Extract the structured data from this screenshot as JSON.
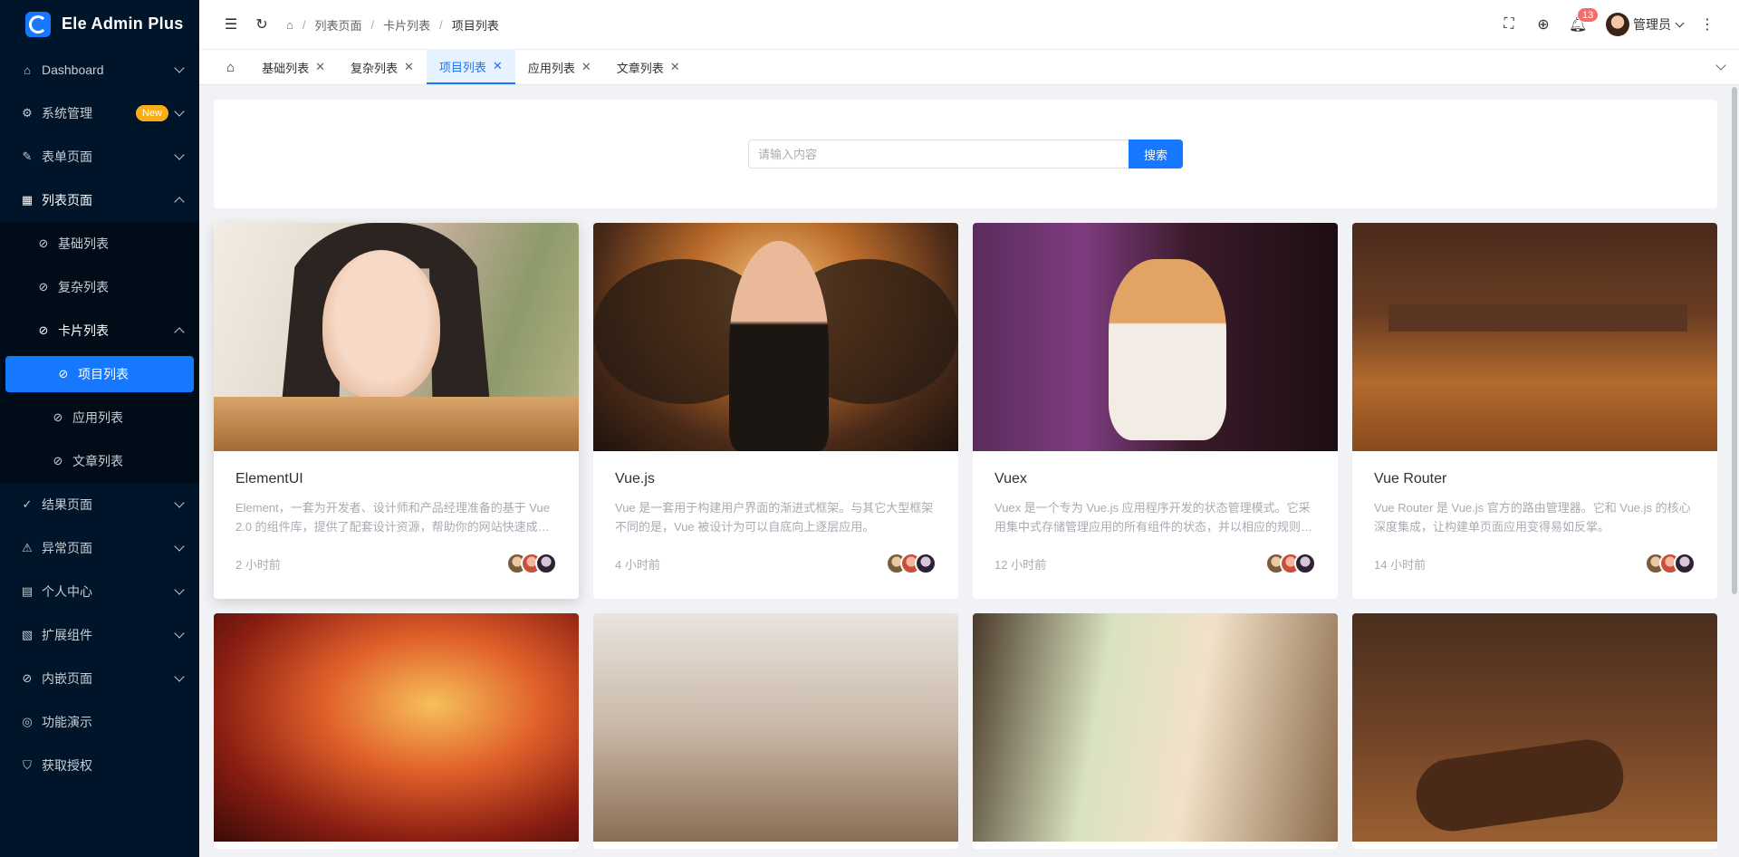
{
  "app": {
    "title": "Ele Admin Plus"
  },
  "sidebar": {
    "items": [
      {
        "label": "Dashboard",
        "icon": "home-icon"
      },
      {
        "label": "系统管理",
        "icon": "gear-icon",
        "badge": "New"
      },
      {
        "label": "表单页面",
        "icon": "edit-icon"
      },
      {
        "label": "列表页面",
        "icon": "table-icon"
      },
      {
        "label": "结果页面",
        "icon": "check-circle-icon"
      },
      {
        "label": "异常页面",
        "icon": "warning-icon"
      },
      {
        "label": "个人中心",
        "icon": "user-card-icon"
      },
      {
        "label": "扩展组件",
        "icon": "grid-icon"
      },
      {
        "label": "内嵌页面",
        "icon": "link-icon"
      },
      {
        "label": "功能演示",
        "icon": "compass-icon"
      },
      {
        "label": "获取授权",
        "icon": "shield-icon"
      }
    ],
    "list_sub": [
      {
        "label": "基础列表"
      },
      {
        "label": "复杂列表"
      },
      {
        "label": "卡片列表"
      }
    ],
    "card_sub": [
      {
        "label": "项目列表"
      },
      {
        "label": "应用列表"
      },
      {
        "label": "文章列表"
      }
    ]
  },
  "header": {
    "breadcrumb": [
      "列表页面",
      "卡片列表",
      "项目列表"
    ],
    "notification_count": "13",
    "user_name": "管理员"
  },
  "tabs": [
    {
      "label": "基础列表"
    },
    {
      "label": "复杂列表"
    },
    {
      "label": "项目列表"
    },
    {
      "label": "应用列表"
    },
    {
      "label": "文章列表"
    }
  ],
  "search": {
    "placeholder": "请输入内容",
    "button": "搜索"
  },
  "cards": [
    {
      "title": "ElementUI",
      "desc": "Element，一套为开发者、设计师和产品经理准备的基于 Vue 2.0 的组件库，提供了配套设计资源，帮助你的网站快速成型。",
      "time": "2 小时前"
    },
    {
      "title": "Vue.js",
      "desc": "Vue 是一套用于构建用户界面的渐进式框架。与其它大型框架不同的是，Vue 被设计为可以自底向上逐层应用。",
      "time": "4 小时前"
    },
    {
      "title": "Vuex",
      "desc": "Vuex 是一个专为 Vue.js 应用程序开发的状态管理模式。它采用集中式存储管理应用的所有组件的状态，并以相应的规则保证状态以一种可预测的方式发生变化。",
      "time": "12 小时前"
    },
    {
      "title": "Vue Router",
      "desc": "Vue Router 是 Vue.js 官方的路由管理器。它和 Vue.js 的核心深度集成，让构建单页面应用变得易如反掌。",
      "time": "14 小时前"
    }
  ]
}
